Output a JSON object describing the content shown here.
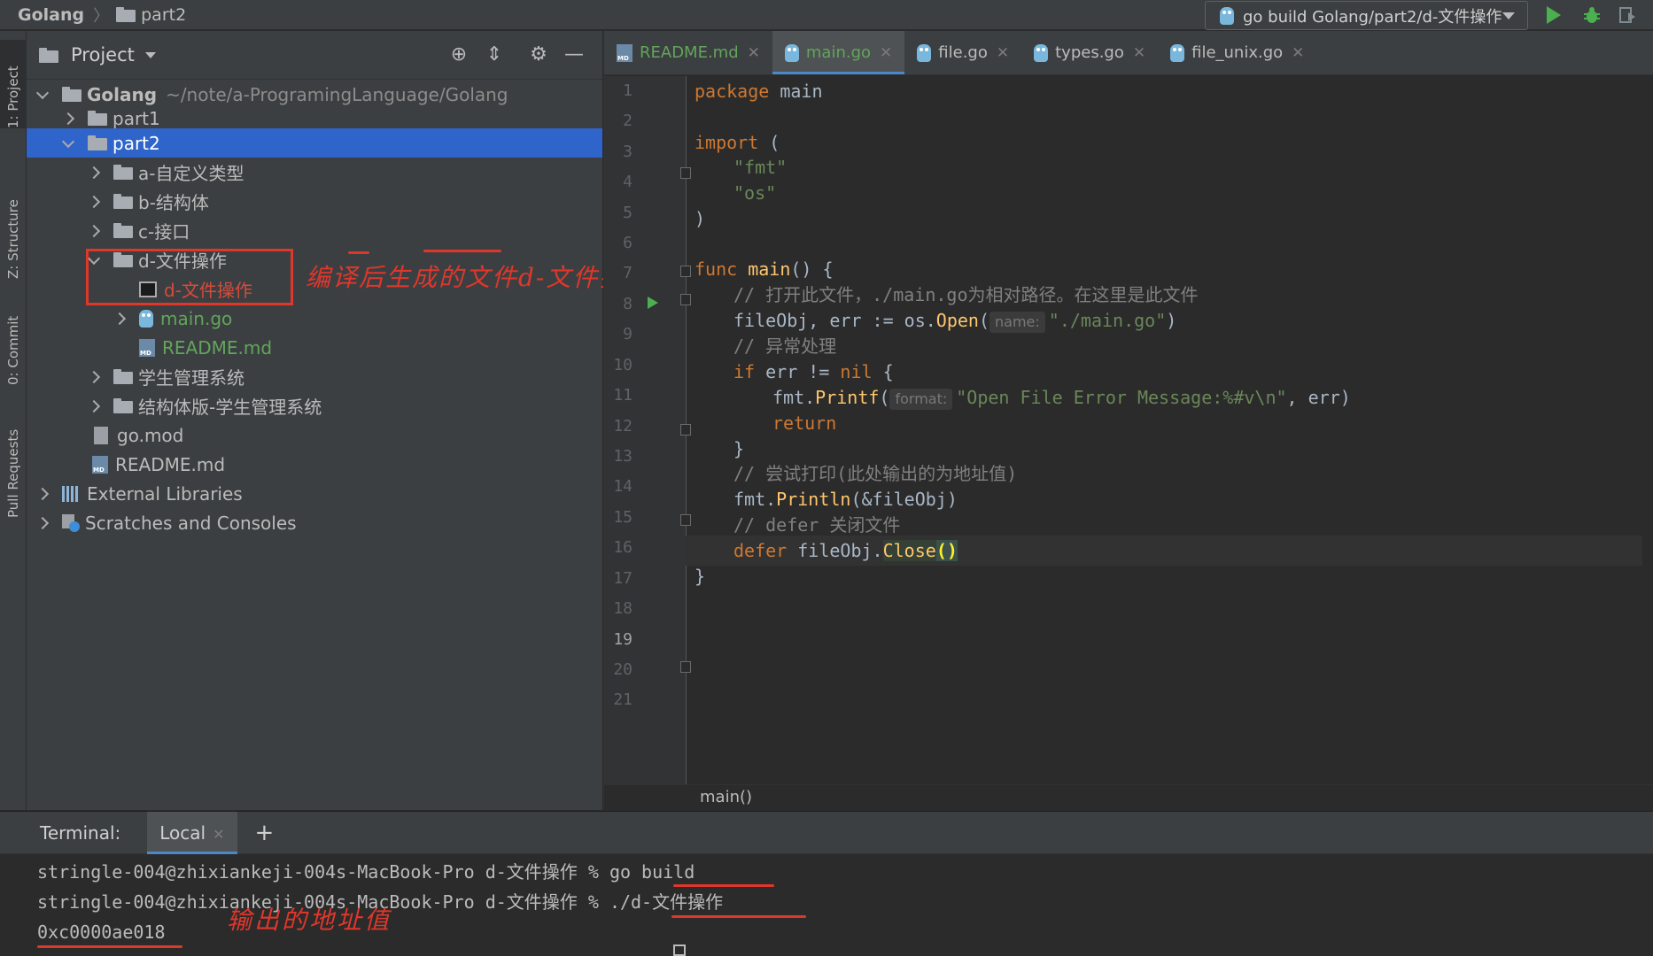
{
  "breadcrumb": {
    "root": "Golang",
    "child": "part2"
  },
  "run_config": {
    "label": "go build Golang/part2/d-文件操作"
  },
  "left_strip": {
    "tabs": [
      "1: Project",
      "Z: Structure",
      "0: Commit",
      "Pull Requests"
    ]
  },
  "project_panel": {
    "title": "Project",
    "tree": [
      {
        "label": "Golang",
        "path": "~/note/a-ProgramingLanguage/Golang"
      },
      {
        "label": "part1"
      },
      {
        "label": "part2"
      },
      {
        "label": "a-自定义类型"
      },
      {
        "label": "b-结构体"
      },
      {
        "label": "c-接口"
      },
      {
        "label": "d-文件操作"
      },
      {
        "label": "d-文件操作"
      },
      {
        "label": "main.go"
      },
      {
        "label": "README.md"
      },
      {
        "label": "学生管理系统"
      },
      {
        "label": "结构体版-学生管理系统"
      },
      {
        "label": "go.mod"
      },
      {
        "label": "README.md"
      },
      {
        "label": "External Libraries"
      },
      {
        "label": "Scratches and Consoles"
      }
    ]
  },
  "annotation": {
    "tree_note": "编译后生成的文件d-文件操作",
    "terminal_note": "输出的地址值"
  },
  "editor": {
    "tabs": [
      {
        "label": "README.md"
      },
      {
        "label": "main.go"
      },
      {
        "label": "file.go"
      },
      {
        "label": "types.go"
      },
      {
        "label": "file_unix.go"
      }
    ],
    "line_numbers": [
      "1",
      "2",
      "3",
      "4",
      "5",
      "6",
      "7",
      "8",
      "9",
      "10",
      "11",
      "12",
      "13",
      "14",
      "15",
      "16",
      "17",
      "18",
      "19",
      "20",
      "21"
    ],
    "code": {
      "l1_kw": "package",
      "l1_rest": " main",
      "l3_kw": "import",
      "l3_rest": " (",
      "l4": "\"fmt\"",
      "l5": "\"os\"",
      "l6": ")",
      "l8_kw": "func",
      "l8_fn": "main",
      "l8_rest": "() {",
      "l9": "// 打开此文件，./main.go为相对路径。在这里是此文件",
      "l10_a": "fileObj",
      "l10_b": ", err := os.",
      "l10_fn": "Open",
      "l10_c": "(",
      "l10_hint": "name:",
      "l10_str": "\"./main.go\"",
      "l10_d": ")",
      "l11": "// 异常处理",
      "l12_kw": "if",
      "l12_b": " err != ",
      "l12_nil": "nil",
      "l12_c": " {",
      "l13_a": "fmt.",
      "l13_fn": "Printf",
      "l13_b": "(",
      "l13_hint": "format:",
      "l13_str": "\"Open File Error Message:%#v\\n\"",
      "l13_c": ", err)",
      "l14_kw": "return",
      "l15": "}",
      "l16": "// 尝试打印(此处输出的为地址值)",
      "l17_a": "fmt.",
      "l17_fn": "Println",
      "l17_b": "(&fileObj)",
      "l18": "// defer 关闭文件",
      "l19_kw": "defer",
      "l19_b": " fileObj.",
      "l19_fn": "Close",
      "l19_paren": "()",
      "l20": "}"
    },
    "bottom_breadcrumb": "main()"
  },
  "terminal": {
    "label": "Terminal:",
    "tab": "Local",
    "lines": [
      {
        "prompt": "stringle-004@zhixiankeji-004s-MacBook-Pro d-文件操作 % ",
        "cmd": "go build"
      },
      {
        "prompt": "stringle-004@zhixiankeji-004s-MacBook-Pro d-文件操作 % ",
        "cmd": "./d-文件操作"
      },
      {
        "prompt": "",
        "cmd": "0xc0000ae018"
      }
    ]
  },
  "colors": {
    "selection": "#2f65ca",
    "annotation": "#e0372b",
    "keyword": "#cc7832",
    "string": "#6a8759",
    "comment": "#808080",
    "function": "#ffc66d"
  }
}
